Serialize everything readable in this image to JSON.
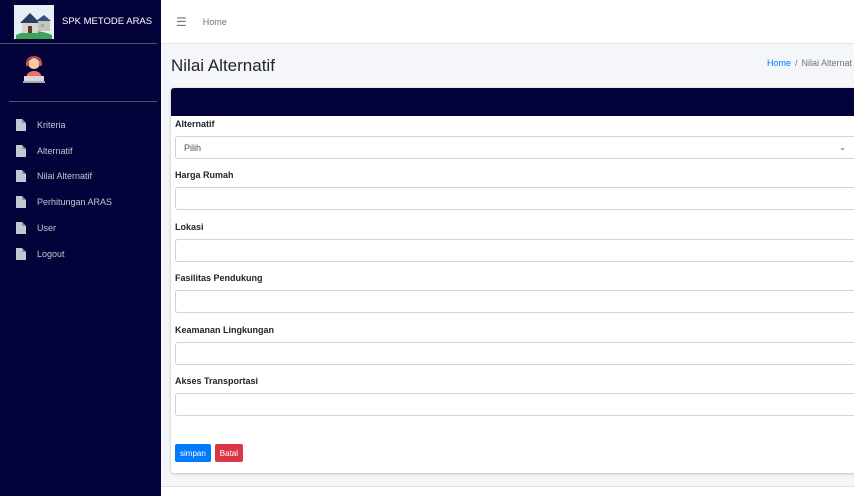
{
  "sidebar": {
    "brand": "SPK METODE ARAS",
    "items": [
      {
        "label": "Kriteria",
        "icon": "file-icon"
      },
      {
        "label": "Alternatif",
        "icon": "file-icon"
      },
      {
        "label": "Nilai Alternatif",
        "icon": "file-icon"
      },
      {
        "label": "Perhitungan ARAS",
        "icon": "file-icon"
      },
      {
        "label": "User",
        "icon": "file-icon"
      },
      {
        "label": "Logout",
        "icon": "file-icon"
      }
    ]
  },
  "topbar": {
    "menu_icon": "hamburger-icon",
    "home_link": "Home"
  },
  "header": {
    "title": "Nilai Alternatif",
    "breadcrumb": {
      "home": "Home",
      "separator": "/",
      "current": "Nilai Alternat"
    }
  },
  "form": {
    "alternatif": {
      "label": "Alternatif",
      "selected": "Pilih"
    },
    "fields": [
      {
        "label": "Harga Rumah",
        "value": ""
      },
      {
        "label": "Lokasi",
        "value": ""
      },
      {
        "label": "Fasilitas Pendukung",
        "value": ""
      },
      {
        "label": "Keamanan Lingkungan",
        "value": ""
      },
      {
        "label": "Akses Transportasi",
        "value": ""
      }
    ],
    "save_label": "simpan",
    "cancel_label": "Batal"
  },
  "colors": {
    "sidebar_bg": "#03023a",
    "primary": "#007bff",
    "danger": "#dc3545"
  }
}
